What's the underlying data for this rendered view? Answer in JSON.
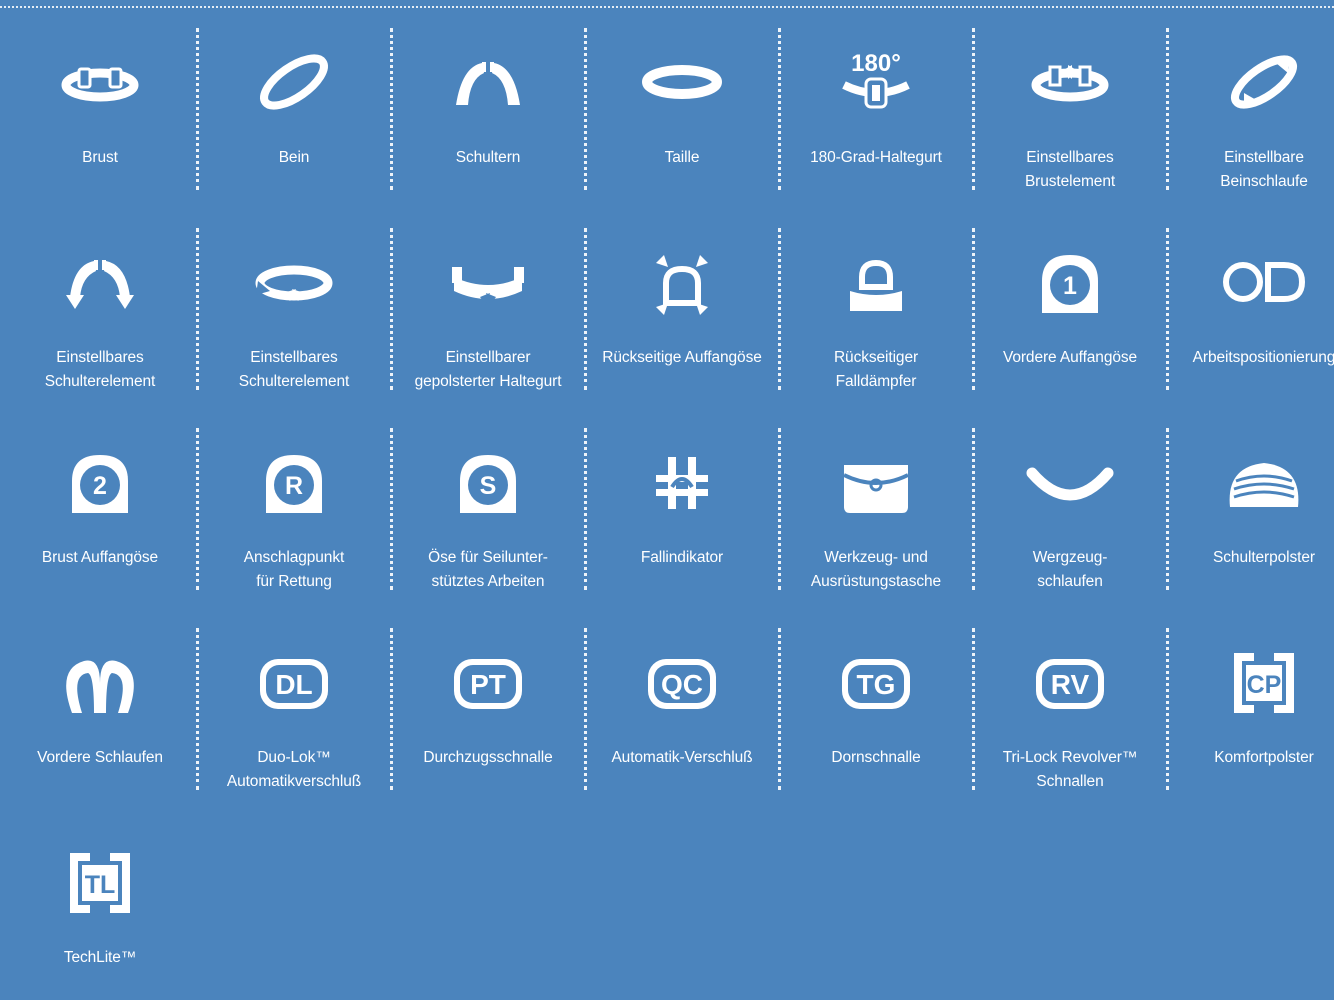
{
  "colors": {
    "background": "#4b84bd",
    "foreground": "#ffffff"
  },
  "rows": [
    [
      {
        "label": "Brust",
        "icon": "chest-strap-icon"
      },
      {
        "label": "Bein",
        "icon": "leg-strap-icon"
      },
      {
        "label": "Schultern",
        "icon": "shoulder-strap-icon"
      },
      {
        "label": "Taille",
        "icon": "waist-belt-icon"
      },
      {
        "label": "180-Grad-Haltegurt",
        "icon": "180-degree-belt-icon"
      },
      {
        "label": "Einstellbares\nBrustelement",
        "icon": "adjustable-chest-icon"
      },
      {
        "label": "Einstellbare\nBeinschlaufe",
        "icon": "adjustable-leg-loop-icon"
      }
    ],
    [
      {
        "label": "Einstellbares\nSchulterelement",
        "icon": "adjustable-shoulder-icon"
      },
      {
        "label": "Einstellbares\nSchulterelement",
        "icon": "adjustable-shoulder-belt-icon"
      },
      {
        "label": "Einstellbarer\ngepolsterter Haltegurt",
        "icon": "adjustable-padded-belt-icon"
      },
      {
        "label": "Rückseitige Auffangöse",
        "icon": "rear-d-ring-icon"
      },
      {
        "label": "Rückseitiger\nFalldämpfer",
        "icon": "rear-shock-absorber-icon"
      },
      {
        "label": "Vordere Auffangöse",
        "icon": "front-d-ring-1-icon",
        "glyph": "1"
      },
      {
        "label": "Arbeitspositionierung",
        "icon": "work-positioning-icon"
      }
    ],
    [
      {
        "label": "Brust Auffangöse",
        "icon": "chest-d-ring-2-icon",
        "glyph": "2"
      },
      {
        "label": "Anschlagpunkt\nfür Rettung",
        "icon": "rescue-anchor-r-icon",
        "glyph": "R"
      },
      {
        "label": "Öse für Seilunter-\nstütztes Arbeiten",
        "icon": "rope-access-s-icon",
        "glyph": "S"
      },
      {
        "label": "Fallindikator",
        "icon": "fall-indicator-icon"
      },
      {
        "label": "Werkzeug- und\nAusrüstungstasche",
        "icon": "tool-pouch-icon"
      },
      {
        "label": "Wergzeug-\nschlaufen",
        "icon": "tool-loops-icon"
      },
      {
        "label": "Schulterpolster",
        "icon": "shoulder-pad-icon"
      }
    ],
    [
      {
        "label": "Vordere Schlaufen",
        "icon": "front-loops-icon"
      },
      {
        "label": "Duo-Lok™\nAutomatikverschluß",
        "icon": "duo-lok-icon",
        "glyph": "DL"
      },
      {
        "label": "Durchzugsschnalle",
        "icon": "pass-through-buckle-icon",
        "glyph": "PT"
      },
      {
        "label": "Automatik-Verschluß",
        "icon": "quick-connect-icon",
        "glyph": "QC"
      },
      {
        "label": "Dornschnalle",
        "icon": "tongue-buckle-icon",
        "glyph": "TG"
      },
      {
        "label": "Tri-Lock Revolver™\nSchnallen",
        "icon": "revolver-buckle-icon",
        "glyph": "RV"
      },
      {
        "label": "Komfortpolster",
        "icon": "comfort-pad-icon",
        "glyph": "CP"
      }
    ],
    [
      {
        "label": "TechLite™",
        "icon": "techlite-icon",
        "glyph": "TL"
      }
    ]
  ]
}
